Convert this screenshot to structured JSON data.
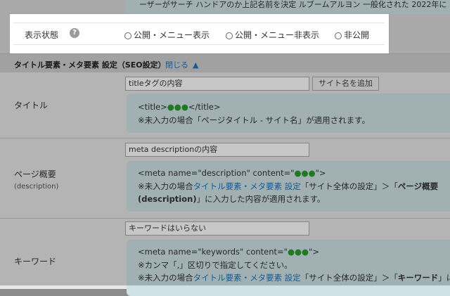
{
  "top_info_line": "ーザーがサーチ   ハンドアのか上記名前を決定   ルブームアルヨン   一般化された 2022年に",
  "visibility": {
    "label": "表示状態",
    "help_icon": "question-circle-icon",
    "options": [
      "公開・メニュー表示",
      "公開・メニュー非表示",
      "非公開"
    ]
  },
  "seo_section": {
    "title": "タイトル要素・メタ要素 設定（SEO設定）",
    "close_link": "閉じる",
    "close_arrow": "▲"
  },
  "title_row": {
    "label": "タイトル",
    "input_value": "titleタグの内容",
    "add_site_name_button": "サイト名を追加",
    "info_line1_prefix": "<title>",
    "info_line1_dots": "●●●",
    "info_line1_suffix": "</title>",
    "info_line2": "※未入力の場合「ページタイトル - サイト名」が適用されます。"
  },
  "description_row": {
    "label": "ページ概要",
    "sublabel": "(description)",
    "input_value": "meta descriptionの内容",
    "info_line1_prefix": "<meta name=\"description\" content=\"",
    "info_line1_dots": "●●●",
    "info_line1_suffix": "\">",
    "info_line2_prefix": "※未入力の場合",
    "info_line2_link": "タイトル要素・メタ要素 設定",
    "info_line2_mid": "「サイト全体の設定」＞「",
    "info_line2_bold": "ページ概要",
    "info_line3_bold": "(description)",
    "info_line3_suffix": "」に入力した内容が適用されます。"
  },
  "keywords_row": {
    "label": "キーワード",
    "input_value": "キーワードはいらない",
    "info_line1_prefix": "<meta name=\"keywords\" content=\"",
    "info_line1_dots": "●●●",
    "info_line1_suffix": "\">",
    "info_line2": "※カンマ「,」区切りで指定してください。",
    "info_line3_prefix": "※未入力の場合",
    "info_line3_link": "タイトル要素・メタ要素 設定",
    "info_line3_mid": "「サイト全体の設定」＞「",
    "info_line3_bold": "キーワード",
    "info_line3_suffix": "」に"
  },
  "colors": {
    "link": "#1e73be",
    "dots": "#2e9a2e",
    "info_bg": "#cfe3e6"
  }
}
